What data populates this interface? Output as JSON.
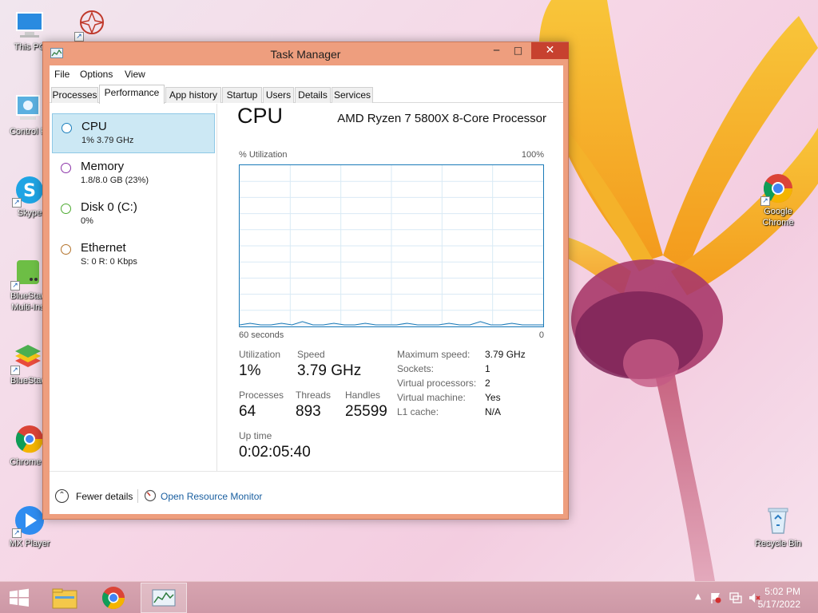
{
  "desktop": {
    "icons_left": [
      {
        "label": "This PC"
      },
      {
        "label": "Control P"
      },
      {
        "label": "Skype"
      },
      {
        "label": "BlueStac\nMulti-Ins"
      },
      {
        "label": "BlueStac"
      },
      {
        "label": "Chrome B"
      },
      {
        "label": "MX Player"
      }
    ],
    "icons_right": [
      {
        "label": "Google\nChrome"
      },
      {
        "label": "Recycle Bin"
      }
    ]
  },
  "window": {
    "title": "Task Manager",
    "minimize": "─",
    "maximize": "□",
    "close": "✕"
  },
  "menu": [
    "File",
    "Options",
    "View"
  ],
  "tabs": [
    "Processes",
    "Performance",
    "App history",
    "Startup",
    "Users",
    "Details",
    "Services"
  ],
  "perf_list": [
    {
      "name": "CPU",
      "sub": "1%  3.79 GHz",
      "color": "#1b7fbd"
    },
    {
      "name": "Memory",
      "sub": "1.8/8.0 GB (23%)",
      "color": "#8b33a8"
    },
    {
      "name": "Disk 0 (C:)",
      "sub": "0%",
      "color": "#4caa2f"
    },
    {
      "name": "Ethernet",
      "sub": "S: 0 R: 0 Kbps",
      "color": "#b3722a"
    }
  ],
  "cpu": {
    "heading": "CPU",
    "model": "AMD Ryzen 7 5800X 8-Core Processor",
    "graph_label_left": "% Utilization",
    "graph_label_right": "100%",
    "graph_time_left": "60 seconds",
    "graph_time_right": "0",
    "stats": {
      "utilization_label": "Utilization",
      "utilization": "1%",
      "speed_label": "Speed",
      "speed": "3.79 GHz",
      "processes_label": "Processes",
      "processes": "64",
      "threads_label": "Threads",
      "threads": "893",
      "handles_label": "Handles",
      "handles": "25599",
      "uptime_label": "Up time",
      "uptime": "0:02:05:40"
    },
    "system": [
      {
        "label": "Maximum speed:",
        "value": "3.79 GHz"
      },
      {
        "label": "Sockets:",
        "value": "1"
      },
      {
        "label": "Virtual processors:",
        "value": "2"
      },
      {
        "label": "Virtual machine:",
        "value": "Yes"
      },
      {
        "label": "L1 cache:",
        "value": "N/A"
      }
    ],
    "history_percent": [
      1,
      2,
      1,
      1,
      2,
      1,
      3,
      1,
      1,
      2,
      1,
      1,
      2,
      1,
      1,
      1,
      2,
      1,
      1,
      1,
      2,
      1,
      1,
      3,
      1,
      1,
      2,
      1,
      1,
      1
    ]
  },
  "footer": {
    "fewer_details": "Fewer details",
    "open_resource_monitor": "Open Resource Monitor"
  },
  "taskbar": {
    "time": "5:02 PM",
    "date": "5/17/2022"
  },
  "colors": {
    "window_frame": "#ee9e7e",
    "close_button": "#c7412f",
    "graph_line": "#1a7ab8",
    "selection": "#cce8f4"
  }
}
